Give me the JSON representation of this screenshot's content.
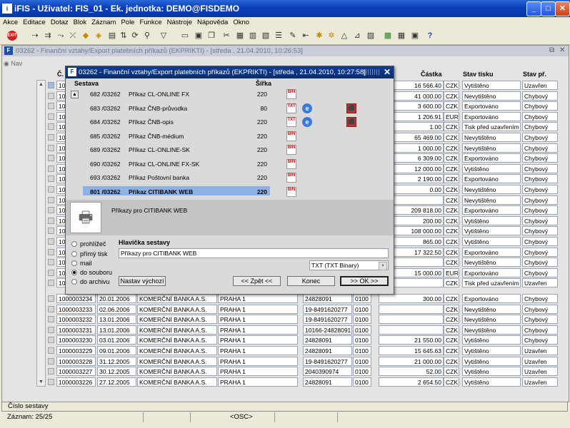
{
  "window": {
    "title": "iFIS - Uživatel: FIS_01 - Ek. jednotka: DEMO@FISDEMO",
    "app_icon": "i"
  },
  "menu": [
    "Akce",
    "Editace",
    "Dotaz",
    "Blok",
    "Záznam",
    "Pole",
    "Funkce",
    "Nástroje",
    "Nápověda",
    "Okno"
  ],
  "inner_window": {
    "title": "03262 - Finanční vztahy/Export platebních příkazů (EKPRIKTI) - [středa , 21.04.2010, 10:26:53]",
    "nav_label": "Nav"
  },
  "table": {
    "headers": {
      "c": "Č.",
      "castka": "Částka",
      "stav_tisku": "Stav tisku",
      "stav_pr": "Stav př."
    },
    "top_rows": [
      {
        "id": "10",
        "castka": "16 566.40",
        "mena": "CZK",
        "tisk": "Vytištěno",
        "pr": "Uzavřen"
      },
      {
        "id": "10",
        "castka": "41 000.00",
        "mena": "CZK",
        "tisk": "Nevytištěno",
        "pr": "Chybový"
      },
      {
        "id": "10",
        "castka": "3 600.00",
        "mena": "CZK",
        "tisk": "Exportováno",
        "pr": "Chybový"
      },
      {
        "id": "10",
        "castka": "1 206.91",
        "mena": "EUR",
        "tisk": "Exportováno",
        "pr": "Chybový"
      },
      {
        "id": "10",
        "castka": "1.00",
        "mena": "CZK",
        "tisk": "Tisk před uzavřením",
        "pr": "Chybový"
      },
      {
        "id": "10",
        "castka": "65 469.00",
        "mena": "CZK",
        "tisk": "Nevytištěno",
        "pr": "Chybový"
      },
      {
        "id": "10",
        "castka": "1 000.00",
        "mena": "CZK",
        "tisk": "Nevytištěno",
        "pr": "Chybový"
      },
      {
        "id": "10",
        "castka": "6 309.00",
        "mena": "CZK",
        "tisk": "Exportováno",
        "pr": "Chybový"
      },
      {
        "id": "10",
        "castka": "12 000.00",
        "mena": "CZK",
        "tisk": "Vytištěno",
        "pr": "Chybový"
      },
      {
        "id": "10",
        "castka": "2 190.00",
        "mena": "CZK",
        "tisk": "Exportováno",
        "pr": "Chybový"
      },
      {
        "id": "10",
        "castka": "0.00",
        "mena": "CZK",
        "tisk": "Nevytištěno",
        "pr": "Chybový"
      },
      {
        "id": "10",
        "castka": "",
        "mena": "CZK",
        "tisk": "Nevytištěno",
        "pr": "Chybový"
      },
      {
        "id": "10",
        "castka": "209 818.00",
        "mena": "CZK",
        "tisk": "Exportováno",
        "pr": "Chybový"
      },
      {
        "id": "10",
        "castka": "200.00",
        "mena": "CZK",
        "tisk": "Vytištěno",
        "pr": "Chybový"
      },
      {
        "id": "10",
        "castka": "108 000.00",
        "mena": "CZK",
        "tisk": "Vytištěno",
        "pr": "Chybový"
      },
      {
        "id": "10",
        "castka": "865.00",
        "mena": "CZK",
        "tisk": "Vytištěno",
        "pr": "Chybový"
      },
      {
        "id": "10",
        "castka": "17 322.50",
        "mena": "CZK",
        "tisk": "Exportováno",
        "pr": "Chybový"
      },
      {
        "id": "10",
        "castka": "",
        "mena": "CZK",
        "tisk": "Nevytištěno",
        "pr": "Chybový"
      },
      {
        "id": "10",
        "castka": "15 000.00",
        "mena": "EUR",
        "tisk": "Exportováno",
        "pr": "Chybový"
      },
      {
        "id": "10",
        "castka": "",
        "mena": "CZK",
        "tisk": "Tisk před uzavřením",
        "pr": "Uzavřen"
      }
    ],
    "bottom_rows": [
      {
        "id": "1000003234",
        "datum": "20.01.2006",
        "banka": "KOMERČNÍ BANKA A.S.",
        "mesto": "PRAHA 1",
        "ucet": "24828091",
        "kod": "0100",
        "castka": "300.00",
        "mena": "CZK",
        "tisk": "Exportováno",
        "pr": "Chybový"
      },
      {
        "id": "1000003233",
        "datum": "02.06.2006",
        "banka": "KOMERČNÍ BANKA A.S.",
        "mesto": "PRAHA 1",
        "ucet": "19-8491620277",
        "kod": "0100",
        "castka": "",
        "mena": "CZK",
        "tisk": "Nevytištěno",
        "pr": "Chybový"
      },
      {
        "id": "1000003232",
        "datum": "13.01.2006",
        "banka": "KOMERČNÍ BANKA A.S.",
        "mesto": "PRAHA 1",
        "ucet": "19-8491620277",
        "kod": "0100",
        "castka": "",
        "mena": "CZK",
        "tisk": "Nevytištěno",
        "pr": "Chybový"
      },
      {
        "id": "1000003231",
        "datum": "13.01.2006",
        "banka": "KOMERČNÍ BANKA A.S.",
        "mesto": "PRAHA 1",
        "ucet": "10166-24828091",
        "kod": "0100",
        "castka": "",
        "mena": "CZK",
        "tisk": "Nevytištěno",
        "pr": "Chybový"
      },
      {
        "id": "1000003230",
        "datum": "03.01.2006",
        "banka": "KOMERČNÍ BANKA A.S.",
        "mesto": "PRAHA 1",
        "ucet": "24828091",
        "kod": "0100",
        "castka": "21 550.00",
        "mena": "CZK",
        "tisk": "Vytištěno",
        "pr": "Chybový"
      },
      {
        "id": "1000003229",
        "datum": "09.01.2006",
        "banka": "KOMERČNÍ BANKA A.S.",
        "mesto": "PRAHA 1",
        "ucet": "24828091",
        "kod": "0100",
        "castka": "15 645.63",
        "mena": "CZK",
        "tisk": "Vytištěno",
        "pr": "Uzavřen"
      },
      {
        "id": "1000003228",
        "datum": "31.12.2005",
        "banka": "KOMERČNÍ BANKA A.S.",
        "mesto": "PRAHA 1",
        "ucet": "19-8491620277",
        "kod": "0100",
        "castka": "21 000.00",
        "mena": "CZK",
        "tisk": "Vytištěno",
        "pr": "Uzavřen"
      },
      {
        "id": "1000003227",
        "datum": "30.12.2005",
        "banka": "KOMERČNÍ BANKA A.S.",
        "mesto": "PRAHA 1",
        "ucet": "2040390974",
        "kod": "0100",
        "castka": "52.00",
        "mena": "CZK",
        "tisk": "Vytištěno",
        "pr": "Uzavřen"
      },
      {
        "id": "1000003226",
        "datum": "27.12.2005",
        "banka": "KOMERČNÍ BANKA A.S.",
        "mesto": "PRAHA 1",
        "ucet": "24828091",
        "kod": "0100",
        "castka": "2 654.50",
        "mena": "CZK",
        "tisk": "Vytištěno",
        "pr": "Uzavřen"
      }
    ]
  },
  "dialog": {
    "title": "03262 - Finanční vztahy/Export platebních příkazů (EKPRIKTI) - [středa , 21.04.2010, 10:27:58]",
    "col_sestava": "Sestava",
    "col_sirka": "Šířka",
    "rows": [
      {
        "num": "682 /03262",
        "name": "Příkaz CL-ONLINE FX",
        "width": "220"
      },
      {
        "num": "683 /03262",
        "name": "Příkaz ČNB-průvodka",
        "width": "80"
      },
      {
        "num": "684 /03262",
        "name": "Příkaz ČNB-opis",
        "width": "220"
      },
      {
        "num": "685 /03262",
        "name": "Příkaz ČNB-médium",
        "width": "220"
      },
      {
        "num": "689 /03262",
        "name": "Příkaz CL-ONLINE-SK",
        "width": "220"
      },
      {
        "num": "690 /03262",
        "name": "Příkaz CL-ONLINE FX-SK",
        "width": "220"
      },
      {
        "num": "693 /03262",
        "name": "Příkaz Poštovní banka",
        "width": "220"
      },
      {
        "num": "801 /03262",
        "name": "Příkaz CITIBANK WEB",
        "width": "220"
      }
    ],
    "description": "Příkazy pro CITIBANK WEB",
    "outputs": [
      "prohlížeč",
      "přímý tisk",
      "mail",
      "do souboru",
      "do archivu"
    ],
    "selected_output": "do souboru",
    "header_label": "Hlavička sestavy",
    "header_value": "Příkazy pro CITIBANK WEB",
    "format_value": "TXT (TXT Binary)",
    "btn_reset": "Nastav výchozí",
    "btn_back": "<< Zpět <<",
    "btn_end": "Konec",
    "btn_ok": ">> OK >>"
  },
  "status": {
    "field_hint": "Číslo sestavy",
    "record": "Záznam: 25/25",
    "mode": "<OSC>"
  }
}
